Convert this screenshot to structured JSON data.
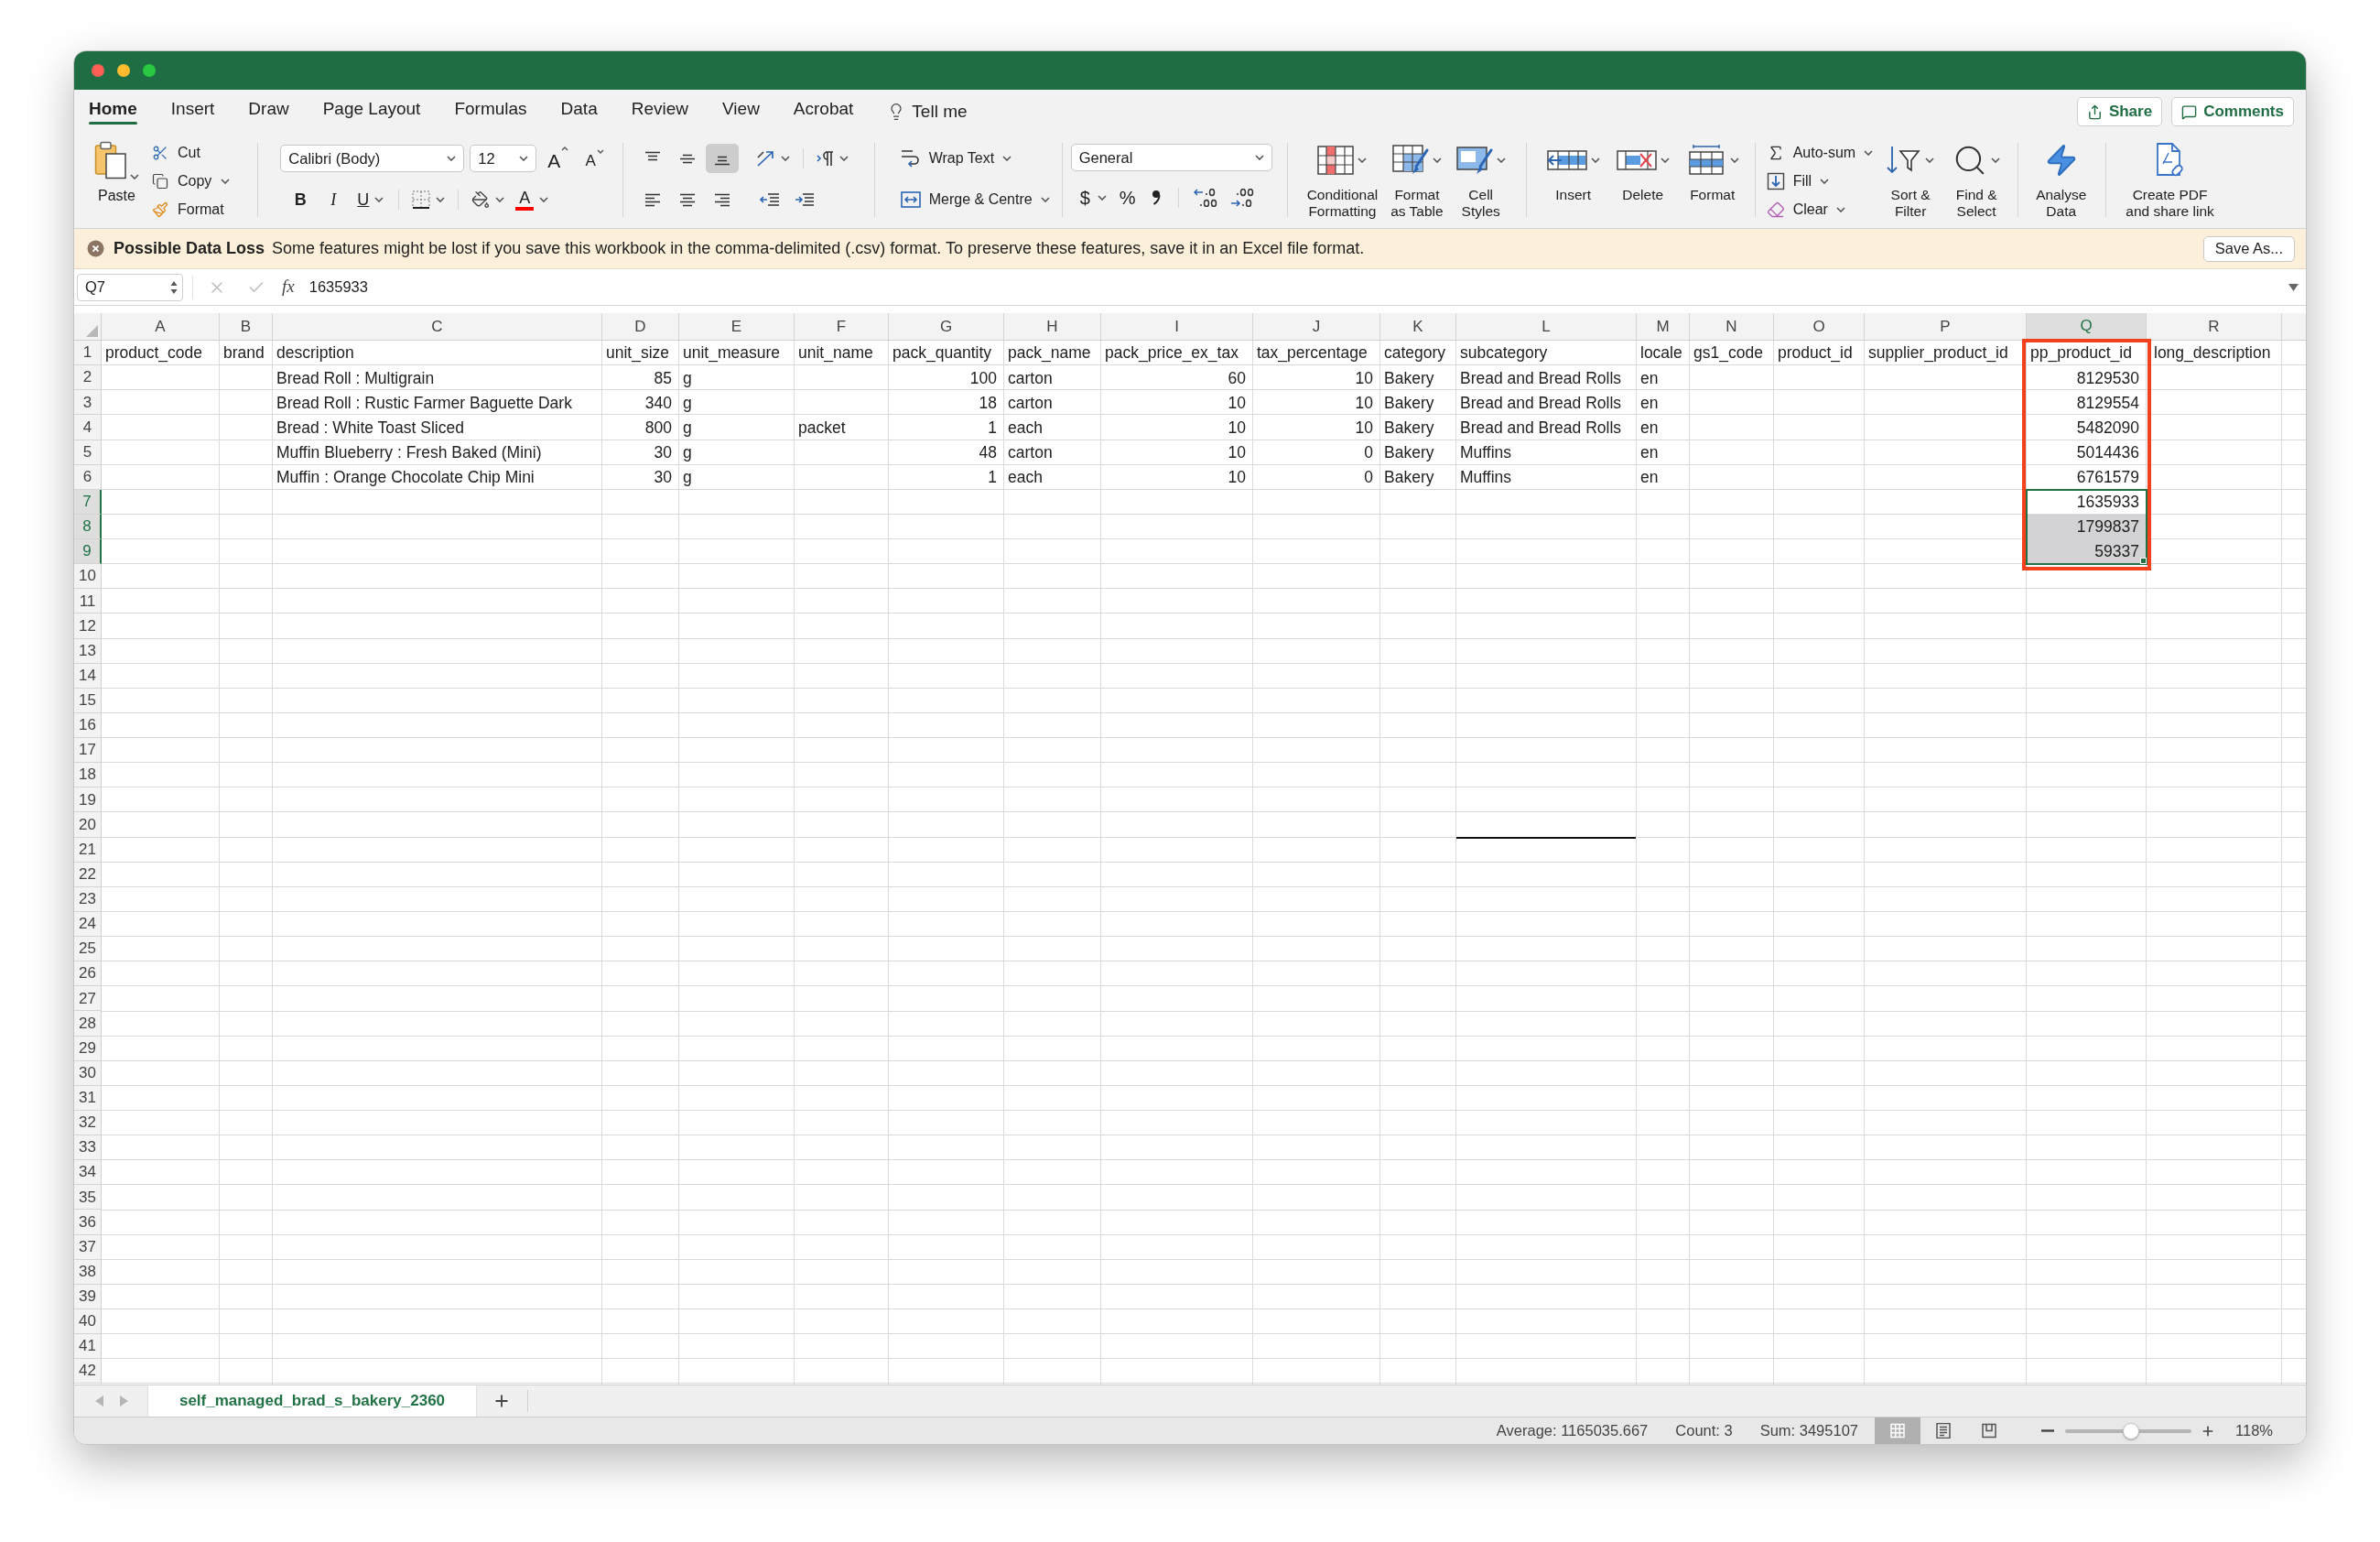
{
  "title_bar": {
    "traffic_lights": [
      {
        "color": "#ff5f57"
      },
      {
        "color": "#febc2e"
      },
      {
        "color": "#28c840"
      }
    ]
  },
  "ribbon_tabs": [
    {
      "label": "Home",
      "selected": true
    },
    {
      "label": "Insert",
      "selected": false
    },
    {
      "label": "Draw",
      "selected": false
    },
    {
      "label": "Page Layout",
      "selected": false
    },
    {
      "label": "Formulas",
      "selected": false
    },
    {
      "label": "Data",
      "selected": false
    },
    {
      "label": "Review",
      "selected": false
    },
    {
      "label": "View",
      "selected": false
    },
    {
      "label": "Acrobat",
      "selected": false
    }
  ],
  "tell_me": "Tell me",
  "share_button": "Share",
  "comments_button": "Comments",
  "clipboard": {
    "paste": "Paste",
    "items": [
      {
        "kind": "cut",
        "label": "Cut"
      },
      {
        "kind": "copy",
        "label": "Copy"
      },
      {
        "kind": "format",
        "label": "Format"
      }
    ]
  },
  "font": {
    "name": "Calibri (Body)",
    "size": "12",
    "grow": "A",
    "shrink": "A",
    "styles": [
      {
        "kind": "bold",
        "label": "B"
      },
      {
        "kind": "italic",
        "label": "I"
      },
      {
        "kind": "underline",
        "label": "U"
      }
    ],
    "color_button": "A"
  },
  "alignment": {
    "vertical": [
      {
        "kind": "top",
        "selected": false
      },
      {
        "kind": "middle",
        "selected": false
      },
      {
        "kind": "bottom",
        "selected": true
      }
    ],
    "horizontal": [
      {
        "kind": "left",
        "selected": false
      },
      {
        "kind": "center",
        "selected": false
      },
      {
        "kind": "right",
        "selected": false
      }
    ]
  },
  "wrap_text": "Wrap Text",
  "merge": "Merge & Centre",
  "number": {
    "format": "General",
    "currency": "$",
    "percent": "%"
  },
  "styles": [
    {
      "kind": "conditional",
      "lines": [
        "Conditional",
        "Formatting"
      ]
    },
    {
      "kind": "table",
      "lines": [
        "Format",
        "as Table"
      ]
    },
    {
      "kind": "cell-styles",
      "lines": [
        "Cell",
        "Styles"
      ]
    }
  ],
  "cells_group": [
    {
      "kind": "insert",
      "lines": [
        "Insert"
      ]
    },
    {
      "kind": "delete",
      "lines": [
        "Delete"
      ]
    },
    {
      "kind": "format",
      "lines": [
        "Format"
      ]
    }
  ],
  "editing": [
    {
      "kind": "autosum",
      "label": "Auto-sum"
    },
    {
      "kind": "fill",
      "label": "Fill"
    },
    {
      "kind": "clear",
      "label": "Clear"
    }
  ],
  "editing_large": [
    {
      "kind": "sort",
      "lines": [
        "Sort &",
        "Filter"
      ]
    },
    {
      "kind": "find",
      "lines": [
        "Find &",
        "Select"
      ]
    }
  ],
  "analysis": [
    {
      "kind": "analyse",
      "lines": [
        "Analyse",
        "Data"
      ]
    }
  ],
  "acrobat": [
    {
      "kind": "pdf",
      "lines": [
        "Create PDF",
        "and share link"
      ]
    }
  ],
  "notification": {
    "title": "Possible Data Loss",
    "message": "Some features might be lost if you save this workbook in the comma-delimited (.csv) format. To preserve these features, save it in an Excel file format.",
    "button": "Save As..."
  },
  "formula_bar": {
    "name_box": "Q7",
    "fx": "fx",
    "formula": "1635933"
  },
  "sheet": {
    "columns": [
      {
        "letter": "A",
        "selected": false,
        "outlined": false
      },
      {
        "letter": "B",
        "selected": false,
        "outlined": false
      },
      {
        "letter": "C",
        "selected": false,
        "outlined": false
      },
      {
        "letter": "D",
        "selected": false,
        "outlined": false
      },
      {
        "letter": "E",
        "selected": false,
        "outlined": false
      },
      {
        "letter": "F",
        "selected": false,
        "outlined": false
      },
      {
        "letter": "G",
        "selected": false,
        "outlined": false
      },
      {
        "letter": "H",
        "selected": false,
        "outlined": false
      },
      {
        "letter": "I",
        "selected": false,
        "outlined": false
      },
      {
        "letter": "J",
        "selected": false,
        "outlined": false
      },
      {
        "letter": "K",
        "selected": false,
        "outlined": false
      },
      {
        "letter": "L",
        "selected": false,
        "outlined": false
      },
      {
        "letter": "M",
        "selected": false,
        "outlined": false
      },
      {
        "letter": "N",
        "selected": false,
        "outlined": false
      },
      {
        "letter": "O",
        "selected": false,
        "outlined": false
      },
      {
        "letter": "P",
        "selected": false,
        "outlined": false
      },
      {
        "letter": "Q",
        "selected": true,
        "outlined": true
      },
      {
        "letter": "R",
        "selected": false,
        "outlined": false
      }
    ],
    "rows": [
      {
        "number": "1",
        "selected": false,
        "cells": [
          {
            "kind": "text",
            "value": "product_code"
          },
          {
            "kind": "text",
            "value": "brand"
          },
          {
            "kind": "text",
            "value": "description"
          },
          {
            "kind": "text",
            "value": "unit_size"
          },
          {
            "kind": "text",
            "value": "unit_measure"
          },
          {
            "kind": "text",
            "value": "unit_name"
          },
          {
            "kind": "text",
            "value": "pack_quantity"
          },
          {
            "kind": "text",
            "value": "pack_name"
          },
          {
            "kind": "text",
            "value": "pack_price_ex_tax"
          },
          {
            "kind": "text",
            "value": "tax_percentage"
          },
          {
            "kind": "text",
            "value": "category"
          },
          {
            "kind": "text",
            "value": "subcategory"
          },
          {
            "kind": "text",
            "value": "locale"
          },
          {
            "kind": "text",
            "value": "gs1_code"
          },
          {
            "kind": "text",
            "value": "product_id"
          },
          {
            "kind": "text",
            "value": "supplier_product_id"
          },
          {
            "kind": "text",
            "value": "pp_product_id"
          },
          {
            "kind": "text",
            "value": "long_description"
          }
        ]
      },
      {
        "number": "2",
        "selected": false,
        "cells": [
          {
            "kind": "blank"
          },
          {
            "kind": "blank"
          },
          {
            "kind": "text",
            "value": "Bread Roll : Multigrain"
          },
          {
            "kind": "number",
            "value": "85"
          },
          {
            "kind": "text",
            "value": "g"
          },
          {
            "kind": "blank"
          },
          {
            "kind": "number",
            "value": "100"
          },
          {
            "kind": "text",
            "value": "carton"
          },
          {
            "kind": "number",
            "value": "60"
          },
          {
            "kind": "number",
            "value": "10"
          },
          {
            "kind": "text",
            "value": "Bakery"
          },
          {
            "kind": "text",
            "value": "Bread and Bread Rolls"
          },
          {
            "kind": "text",
            "value": "en"
          },
          {
            "kind": "blank"
          },
          {
            "kind": "blank"
          },
          {
            "kind": "blank"
          },
          {
            "kind": "number",
            "value": "8129530"
          }
        ]
      },
      {
        "number": "3",
        "selected": false,
        "cells": [
          {
            "kind": "blank"
          },
          {
            "kind": "blank"
          },
          {
            "kind": "text",
            "value": "Bread Roll : Rustic Farmer Baguette Dark"
          },
          {
            "kind": "number",
            "value": "340"
          },
          {
            "kind": "text",
            "value": "g"
          },
          {
            "kind": "blank"
          },
          {
            "kind": "number",
            "value": "18"
          },
          {
            "kind": "text",
            "value": "carton"
          },
          {
            "kind": "number",
            "value": "10"
          },
          {
            "kind": "number",
            "value": "10"
          },
          {
            "kind": "text",
            "value": "Bakery"
          },
          {
            "kind": "text",
            "value": "Bread and Bread Rolls"
          },
          {
            "kind": "text",
            "value": "en"
          },
          {
            "kind": "blank"
          },
          {
            "kind": "blank"
          },
          {
            "kind": "blank"
          },
          {
            "kind": "number",
            "value": "8129554"
          }
        ]
      },
      {
        "number": "4",
        "selected": false,
        "cells": [
          {
            "kind": "blank"
          },
          {
            "kind": "blank"
          },
          {
            "kind": "text",
            "value": "Bread : White Toast Sliced"
          },
          {
            "kind": "number",
            "value": "800"
          },
          {
            "kind": "text",
            "value": "g"
          },
          {
            "kind": "text",
            "value": "packet"
          },
          {
            "kind": "number",
            "value": "1"
          },
          {
            "kind": "text",
            "value": "each"
          },
          {
            "kind": "number",
            "value": "10"
          },
          {
            "kind": "number",
            "value": "10"
          },
          {
            "kind": "text",
            "value": "Bakery"
          },
          {
            "kind": "text",
            "value": "Bread and Bread Rolls"
          },
          {
            "kind": "text",
            "value": "en"
          },
          {
            "kind": "blank"
          },
          {
            "kind": "blank"
          },
          {
            "kind": "blank"
          },
          {
            "kind": "number",
            "value": "5482090"
          }
        ]
      },
      {
        "number": "5",
        "selected": false,
        "cells": [
          {
            "kind": "blank"
          },
          {
            "kind": "blank"
          },
          {
            "kind": "text",
            "value": "Muffin Blueberry : Fresh Baked (Mini)"
          },
          {
            "kind": "number",
            "value": "30"
          },
          {
            "kind": "text",
            "value": "g"
          },
          {
            "kind": "blank"
          },
          {
            "kind": "number",
            "value": "48"
          },
          {
            "kind": "text",
            "value": "carton"
          },
          {
            "kind": "number",
            "value": "10"
          },
          {
            "kind": "number",
            "value": "0"
          },
          {
            "kind": "text",
            "value": "Bakery"
          },
          {
            "kind": "text",
            "value": "Muffins"
          },
          {
            "kind": "text",
            "value": "en"
          },
          {
            "kind": "blank"
          },
          {
            "kind": "blank"
          },
          {
            "kind": "blank"
          },
          {
            "kind": "number",
            "value": "5014436"
          }
        ]
      },
      {
        "number": "6",
        "selected": false,
        "cells": [
          {
            "kind": "blank"
          },
          {
            "kind": "blank"
          },
          {
            "kind": "text",
            "value": "Muffin : Orange Chocolate Chip Mini"
          },
          {
            "kind": "number",
            "value": "30"
          },
          {
            "kind": "text",
            "value": "g"
          },
          {
            "kind": "blank"
          },
          {
            "kind": "number",
            "value": "1"
          },
          {
            "kind": "text",
            "value": "each"
          },
          {
            "kind": "number",
            "value": "10"
          },
          {
            "kind": "number",
            "value": "0"
          },
          {
            "kind": "text",
            "value": "Bakery"
          },
          {
            "kind": "text",
            "value": "Muffins"
          },
          {
            "kind": "text",
            "value": "en"
          },
          {
            "kind": "blank"
          },
          {
            "kind": "blank"
          },
          {
            "kind": "blank"
          },
          {
            "kind": "number",
            "value": "6761579"
          }
        ]
      },
      {
        "number": "7",
        "selected": true,
        "cells": [
          {
            "kind": "blank"
          },
          {
            "kind": "blank"
          },
          {
            "kind": "blank"
          },
          {
            "kind": "blank"
          },
          {
            "kind": "blank"
          },
          {
            "kind": "blank"
          },
          {
            "kind": "blank"
          },
          {
            "kind": "blank"
          },
          {
            "kind": "blank"
          },
          {
            "kind": "blank"
          },
          {
            "kind": "blank"
          },
          {
            "kind": "blank"
          },
          {
            "kind": "blank"
          },
          {
            "kind": "blank"
          },
          {
            "kind": "blank"
          },
          {
            "kind": "blank"
          },
          {
            "kind": "number",
            "value": "1635933"
          }
        ]
      },
      {
        "number": "8",
        "selected": true,
        "cells": [
          {
            "kind": "blank"
          },
          {
            "kind": "blank"
          },
          {
            "kind": "blank"
          },
          {
            "kind": "blank"
          },
          {
            "kind": "blank"
          },
          {
            "kind": "blank"
          },
          {
            "kind": "blank"
          },
          {
            "kind": "blank"
          },
          {
            "kind": "blank"
          },
          {
            "kind": "blank"
          },
          {
            "kind": "blank"
          },
          {
            "kind": "blank"
          },
          {
            "kind": "blank"
          },
          {
            "kind": "blank"
          },
          {
            "kind": "blank"
          },
          {
            "kind": "blank"
          },
          {
            "kind": "number",
            "value": "1799837"
          }
        ]
      },
      {
        "number": "9",
        "selected": true,
        "cells": [
          {
            "kind": "blank"
          },
          {
            "kind": "blank"
          },
          {
            "kind": "blank"
          },
          {
            "kind": "blank"
          },
          {
            "kind": "blank"
          },
          {
            "kind": "blank"
          },
          {
            "kind": "blank"
          },
          {
            "kind": "blank"
          },
          {
            "kind": "blank"
          },
          {
            "kind": "blank"
          },
          {
            "kind": "blank"
          },
          {
            "kind": "blank"
          },
          {
            "kind": "blank"
          },
          {
            "kind": "blank"
          },
          {
            "kind": "blank"
          },
          {
            "kind": "blank"
          },
          {
            "kind": "number",
            "value": "59337"
          }
        ]
      },
      {
        "number": "10",
        "selected": false
      },
      {
        "number": "11",
        "selected": false
      },
      {
        "number": "12",
        "selected": false
      },
      {
        "number": "13",
        "selected": false
      },
      {
        "number": "14",
        "selected": false
      },
      {
        "number": "15",
        "selected": false
      },
      {
        "number": "16",
        "selected": false
      },
      {
        "number": "17",
        "selected": false
      },
      {
        "number": "18",
        "selected": false
      },
      {
        "number": "19",
        "selected": false
      },
      {
        "number": "20",
        "selected": false,
        "cells": [
          {
            "kind": "blank"
          },
          {
            "kind": "blank"
          },
          {
            "kind": "blank"
          },
          {
            "kind": "blank"
          },
          {
            "kind": "blank"
          },
          {
            "kind": "blank"
          },
          {
            "kind": "blank"
          },
          {
            "kind": "blank"
          },
          {
            "kind": "blank"
          },
          {
            "kind": "blank"
          },
          {
            "kind": "blank"
          },
          {
            "kind": "bottom-border"
          }
        ]
      },
      {
        "number": "21",
        "selected": false
      },
      {
        "number": "22",
        "selected": false
      },
      {
        "number": "23",
        "selected": false
      },
      {
        "number": "24",
        "selected": false
      },
      {
        "number": "25",
        "selected": false
      },
      {
        "number": "26",
        "selected": false
      },
      {
        "number": "27",
        "selected": false
      },
      {
        "number": "28",
        "selected": false
      },
      {
        "number": "29",
        "selected": false
      },
      {
        "number": "30",
        "selected": false
      },
      {
        "number": "31",
        "selected": false
      },
      {
        "number": "32",
        "selected": false
      },
      {
        "number": "33",
        "selected": false
      },
      {
        "number": "34",
        "selected": false
      },
      {
        "number": "35",
        "selected": false
      },
      {
        "number": "36",
        "selected": false
      },
      {
        "number": "37",
        "selected": false
      },
      {
        "number": "38",
        "selected": false
      },
      {
        "number": "39",
        "selected": false
      },
      {
        "number": "40",
        "selected": false
      },
      {
        "number": "41",
        "selected": false
      },
      {
        "number": "42",
        "selected": false
      }
    ]
  },
  "sheet_tabs": [
    {
      "label": "self_managed_brad_s_bakery_2360",
      "selected": true
    }
  ],
  "status_bar": {
    "average": "Average: 1165035.667",
    "count": "Count: 3",
    "sum": "Sum: 3495107",
    "views": [
      {
        "kind": "normal",
        "selected": true
      },
      {
        "kind": "page-layout",
        "selected": false
      },
      {
        "kind": "page-break",
        "selected": false
      }
    ],
    "zoom": {
      "level": 0.52,
      "reading": "118%"
    }
  }
}
